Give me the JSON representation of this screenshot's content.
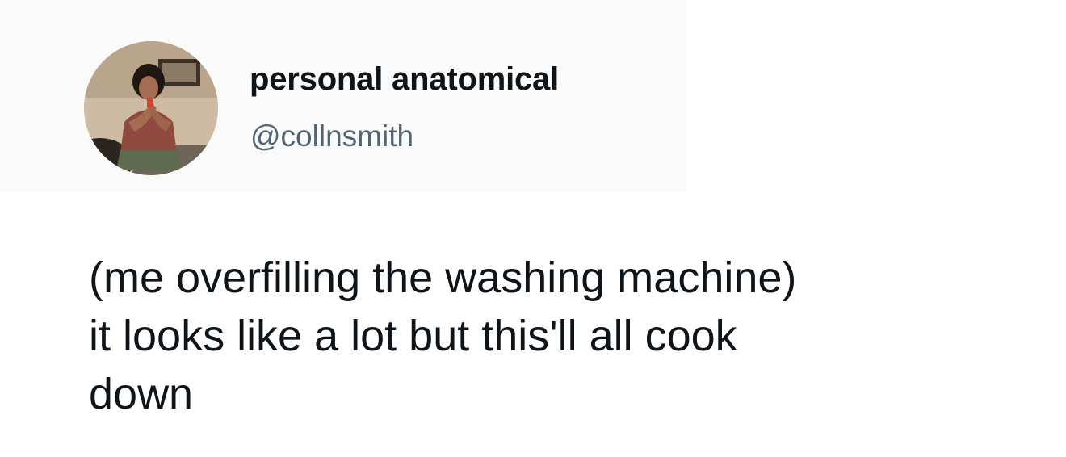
{
  "author": {
    "display_name": "personal anatomical",
    "handle": "@collnsmith",
    "avatar_icon": "profile-photo-avatar"
  },
  "tweet": {
    "text": "(me overfilling the washing machine)\nit looks like a lot but this'll all cook\ndown"
  },
  "colors": {
    "text_primary": "#0f1419",
    "text_secondary": "#536471",
    "background": "#ffffff"
  }
}
